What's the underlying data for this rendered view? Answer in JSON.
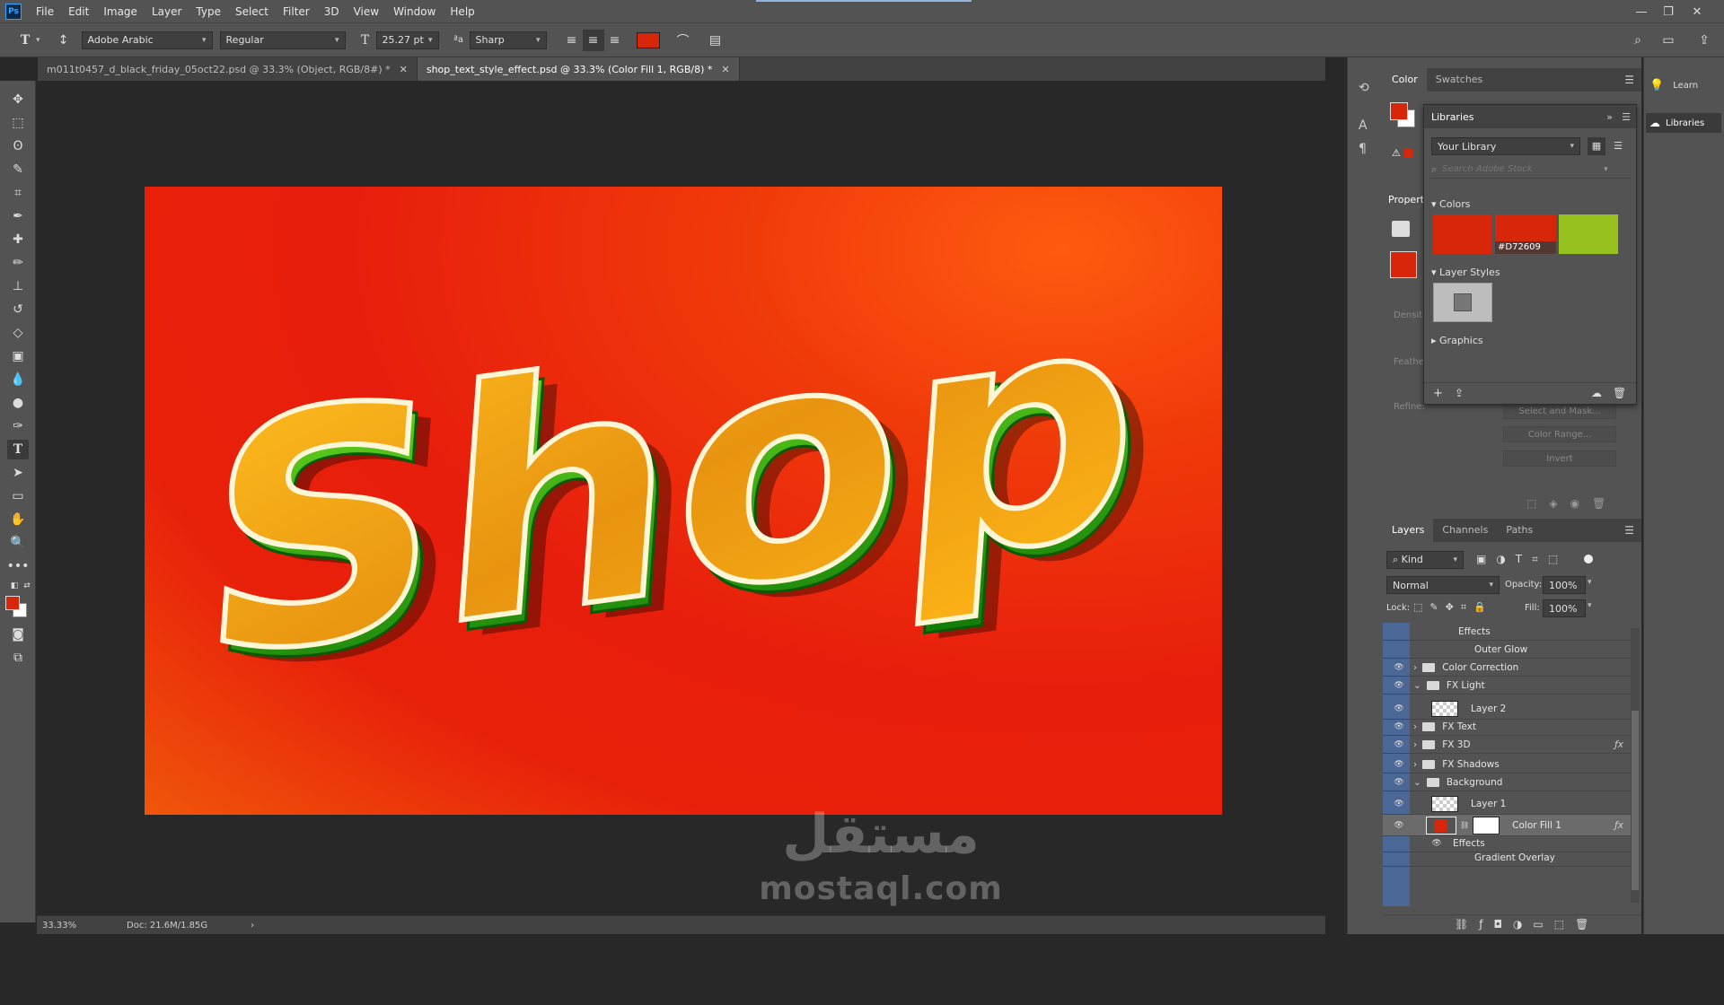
{
  "app": {
    "logo": "Ps",
    "menu": [
      "File",
      "Edit",
      "Image",
      "Layer",
      "Type",
      "Select",
      "Filter",
      "3D",
      "View",
      "Window",
      "Help"
    ]
  },
  "options_bar": {
    "font_family": "Adobe Arabic",
    "font_style": "Regular",
    "font_size": "25.27 pt",
    "antialias": "Sharp",
    "text_color": "#d72609",
    "tool_icon": "type-tool-icon"
  },
  "tabs": [
    {
      "label": "m011t0457_d_black_friday_05oct22.psd @ 33.3% (Object, RGB/8#) *",
      "active": false
    },
    {
      "label": "shop_text_style_effect.psd @ 33.3% (Color Fill 1, RGB/8) *",
      "active": true
    }
  ],
  "artwork": {
    "text": "Shop",
    "background_color": "#e81e0c",
    "text_face_color": "#f0a010",
    "extrude_color": "#2a9a10"
  },
  "watermark": {
    "arabic": "مستقل",
    "latin": "mostaql.com"
  },
  "status_bar": {
    "zoom": "33.33%",
    "doc": "Doc: 21.6M/1.85G"
  },
  "color_panel": {
    "tabs": [
      "Color",
      "Swatches"
    ],
    "foreground": "#d72609",
    "background": "#ffffff"
  },
  "properties_panel": {
    "tab": "Propert",
    "labels": [
      "Density",
      "Feather",
      "Refine:"
    ],
    "buttons": [
      "Select and Mask...",
      "Color Range...",
      "Invert"
    ]
  },
  "libraries": {
    "title": "Libraries",
    "library_name": "Your Library",
    "search_placeholder": "Search Adobe Stock",
    "sections": {
      "colors": "Colors",
      "layer_styles": "Layer Styles",
      "graphics": "Graphics"
    },
    "colors": [
      {
        "hex": "#d72609",
        "label": ""
      },
      {
        "hex": "#d72609",
        "label": "#D72609"
      },
      {
        "hex": "#96c11f",
        "label": ""
      }
    ]
  },
  "layers_panel": {
    "tabs": [
      "Layers",
      "Channels",
      "Paths"
    ],
    "filter": "Kind",
    "blend_mode": "Normal",
    "opacity_label": "Opacity:",
    "opacity": "100%",
    "lock_label": "Lock:",
    "fill_label": "Fill:",
    "fill": "100%",
    "rows": [
      {
        "name": "Effects",
        "kind": "effects-header",
        "indent": 1
      },
      {
        "name": "Outer Glow",
        "kind": "effect",
        "indent": 2
      },
      {
        "name": "Color Correction",
        "kind": "group",
        "indent": 0
      },
      {
        "name": "FX Light",
        "kind": "group-open",
        "indent": 0
      },
      {
        "name": "Layer 2",
        "kind": "layer",
        "indent": 1
      },
      {
        "name": "FX Text",
        "kind": "group",
        "indent": 0
      },
      {
        "name": "FX 3D",
        "kind": "group",
        "indent": 0,
        "fx": true
      },
      {
        "name": "FX Shadows",
        "kind": "group",
        "indent": 0
      },
      {
        "name": "Background",
        "kind": "group-open",
        "indent": 0
      },
      {
        "name": "Layer 1",
        "kind": "layer",
        "indent": 1
      },
      {
        "name": "Color Fill 1",
        "kind": "fill-layer",
        "indent": 1,
        "fx": true,
        "selected": true
      },
      {
        "name": "Effects",
        "kind": "effects-header",
        "indent": 2
      },
      {
        "name": "Gradient Overlay",
        "kind": "effect",
        "indent": 3
      }
    ]
  },
  "learn_dock": {
    "items": [
      "Learn",
      "Libraries"
    ]
  }
}
